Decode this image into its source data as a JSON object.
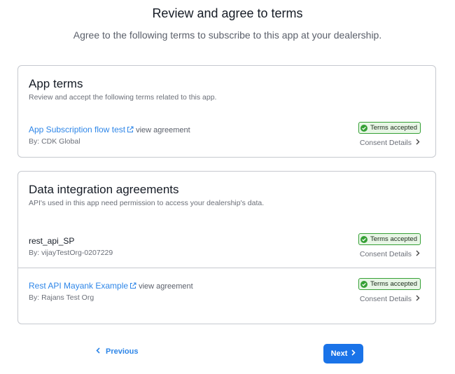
{
  "header": {
    "title": "Review and agree to terms",
    "subtitle": "Agree to the following terms to subscribe to this app at your dealership."
  },
  "app_terms": {
    "title": "App terms",
    "description": "Review and accept the following terms related to this app.",
    "items": [
      {
        "name": "App Subscription flow test",
        "view_agreement": "view agreement",
        "by": "By: CDK Global",
        "status": "Terms accepted",
        "consent": "Consent Details"
      }
    ]
  },
  "data_integration": {
    "title": "Data integration agreements",
    "description": "API's used in this app need permission to access your dealership's data.",
    "items": [
      {
        "name": "rest_api_SP",
        "by": "By: vijayTestOrg-0207229",
        "status": "Terms accepted",
        "consent": "Consent Details"
      },
      {
        "name": "Rest API Mayank Example",
        "view_agreement": "view agreement",
        "by": "By: Rajans Test Org",
        "status": "Terms accepted",
        "consent": "Consent Details"
      }
    ]
  },
  "footer": {
    "previous_label": "Previous",
    "next_label": "Next"
  },
  "colors": {
    "link": "#2e86e8",
    "primary_button": "#1a73e8",
    "badge_border": "#35a035",
    "badge_bg": "#e8f6e6"
  },
  "icons": {
    "external_link": "external-link-icon",
    "accepted": "check-circle-icon",
    "chevron_right": "chevron-right-icon",
    "chevron_left": "chevron-left-icon"
  }
}
